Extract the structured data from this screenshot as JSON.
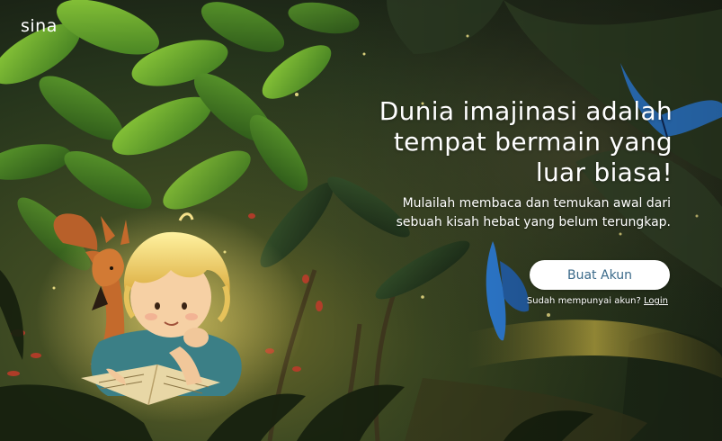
{
  "brand": {
    "logo_text": "sina"
  },
  "hero": {
    "headline_line1": "Dunia imajinasi adalah",
    "headline_line2": "tempat bermain yang",
    "headline_line3": "luar biasa!",
    "subtext_line1": "Mulailah membaca dan temukan awal dari",
    "subtext_line2": "sebuah kisah hebat yang belum terungkap."
  },
  "actions": {
    "signup_label": "Buat Akun",
    "login_prompt": "Sudah mempunyai akun?",
    "login_link": "Login"
  },
  "colors": {
    "cta_text": "#3b6a8a",
    "cta_background": "#ffffff",
    "headline": "#ffffff"
  },
  "illustration": {
    "subject": "child reading a book with a fox in a glowing forest",
    "elements": [
      "child-reading",
      "fox",
      "book",
      "jungle-leaves",
      "blue-butterfly",
      "glowing-path"
    ]
  }
}
